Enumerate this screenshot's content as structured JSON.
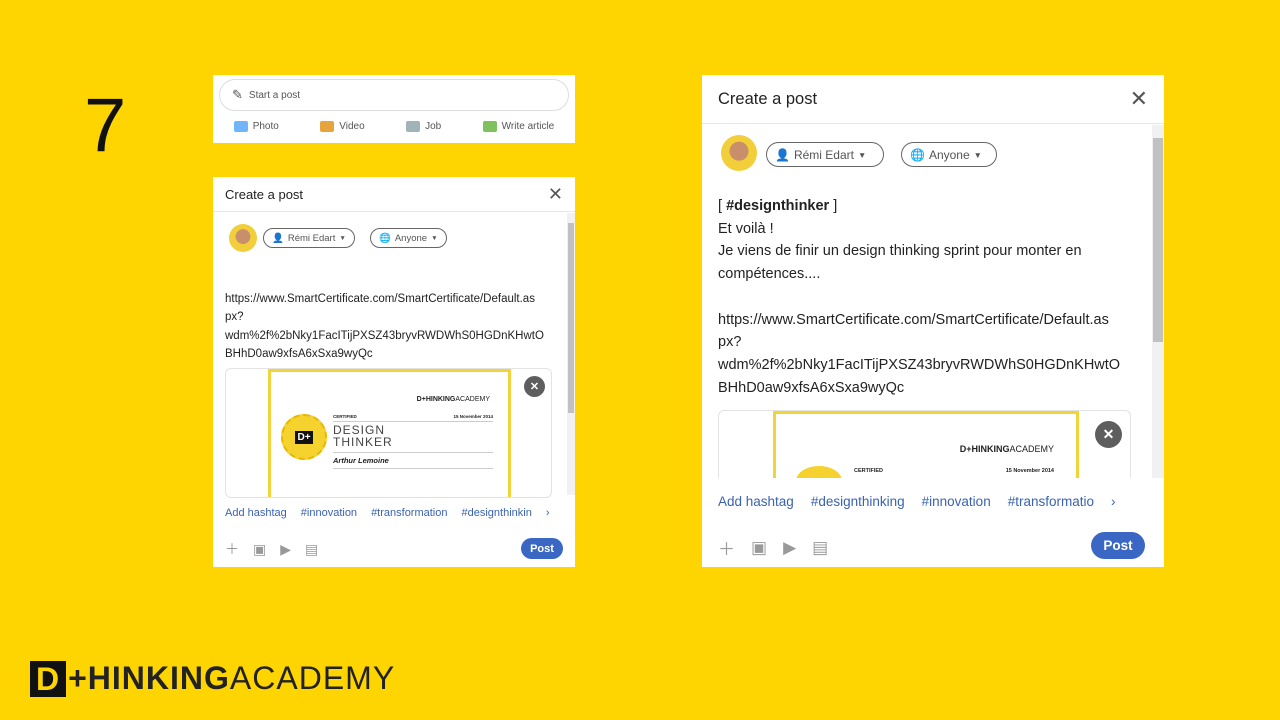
{
  "step_number": "7",
  "start_post": {
    "placeholder": "Start a post",
    "actions": [
      {
        "label": "Photo",
        "icon": "photo-icon",
        "color": "#70b5f9"
      },
      {
        "label": "Video",
        "icon": "video-icon",
        "color": "#e7a33e"
      },
      {
        "label": "Job",
        "icon": "job-icon",
        "color": "#a0b4b7"
      },
      {
        "label": "Write article",
        "icon": "article-icon",
        "color": "#7fc15e"
      }
    ]
  },
  "modal_small": {
    "title": "Create a post",
    "author": "Rémi Edart",
    "visibility": "Anyone",
    "url_lines": [
      "https://www.SmartCertificate.com/SmartCertificate/Default.as",
      "px?",
      "wdm%2f%2bNky1FacITijPXSZ43bryvRWDWhS0HGDnKHwtO",
      "BHhD0aw9xfsA6xSxa9wyQc"
    ],
    "hashtags": [
      "Add hashtag",
      "#innovation",
      "#transformation",
      "#designthinkin"
    ],
    "post_label": "Post"
  },
  "modal_large": {
    "title": "Create a post",
    "author": "Rémi Edart",
    "visibility": "Anyone",
    "lines": [
      "[ ",
      "#designthinker",
      " ]",
      "Et voilà !",
      "Je viens de finir un design thinking sprint pour monter en",
      "compétences...."
    ],
    "url_lines": [
      "https://www.SmartCertificate.com/SmartCertificate/Default.as",
      "px?",
      "wdm%2f%2bNky1FacITijPXSZ43bryvRWDWhS0HGDnKHwtO",
      "BHhD0aw9xfsA6xSxa9wyQc"
    ],
    "hashtags": [
      "Add hashtag",
      "#designthinking",
      "#innovation",
      "#transformatio"
    ],
    "post_label": "Post"
  },
  "certificate": {
    "brand_bold": "D+HINKING",
    "brand_light": "ACADEMY",
    "certified": "CERTIFIED",
    "date": "15 November 2014",
    "title_1": "DESIGN",
    "title_2": "THINKER",
    "name": "Arthur Lemoine",
    "badge": "D+"
  },
  "footer_logo": {
    "mark": "D",
    "bold": "+HINKING",
    "light": "ACADEMY"
  },
  "colors": {
    "background": "#FED500",
    "accent": "#3a67c4"
  }
}
